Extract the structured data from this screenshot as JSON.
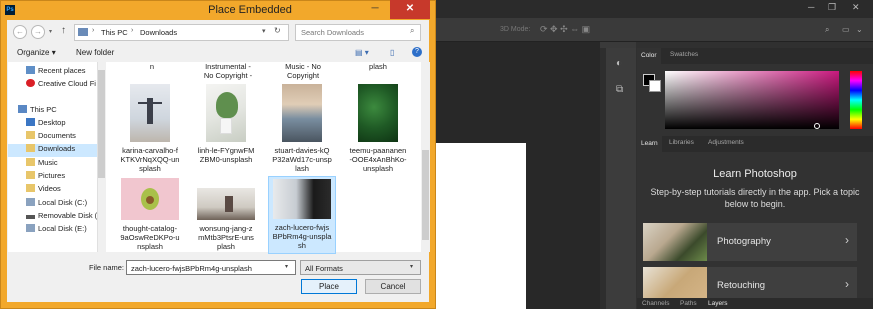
{
  "dialog": {
    "title": "Place Embedded",
    "app_icon": "Ps",
    "breadcrumb": [
      "This PC",
      "Downloads"
    ],
    "search_placeholder": "Search Downloads",
    "organize_label": "Organize",
    "new_folder_label": "New folder",
    "nav_items": [
      {
        "label": "Recent places",
        "icon": "recent-places-icon",
        "selected": false
      },
      {
        "label": "Creative Cloud Fi",
        "icon": "creative-cloud-icon",
        "selected": false
      },
      {
        "label": "This PC",
        "icon": "computer-icon",
        "selected": false
      },
      {
        "label": "Desktop",
        "icon": "folder-icon",
        "selected": false
      },
      {
        "label": "Documents",
        "icon": "folder-icon",
        "selected": false
      },
      {
        "label": "Downloads",
        "icon": "folder-icon",
        "selected": true
      },
      {
        "label": "Music",
        "icon": "music-icon",
        "selected": false
      },
      {
        "label": "Pictures",
        "icon": "folder-icon",
        "selected": false
      },
      {
        "label": "Videos",
        "icon": "folder-icon",
        "selected": false
      },
      {
        "label": "Local Disk (C:)",
        "icon": "disk-icon",
        "selected": false
      },
      {
        "label": "Removable Disk (",
        "icon": "removable-disk-icon",
        "selected": false
      },
      {
        "label": "Local Disk (E:)",
        "icon": "disk-icon",
        "selected": false
      }
    ],
    "truncated_top_items": [
      "n",
      "Instrumental -\nNo Copyright -",
      "Music - No\nCopyright",
      "plash"
    ],
    "files": [
      {
        "name": "karina-carvalho-fKTKVrNqXQQ-unsplash",
        "lines": [
          "karina-carvalho-f",
          "KTKVrNqXQQ-un",
          "splash"
        ],
        "selected": false
      },
      {
        "name": "linh-le-FYgnwFMZBM0-unsplash",
        "lines": [
          "linh-le-FYgnwFM",
          "ZBM0-unsplash"
        ],
        "selected": false
      },
      {
        "name": "stuart-davies-kQP32aWd17c-unsplash",
        "lines": [
          "stuart-davies-kQ",
          "P32aWd17c-unsp",
          "lash"
        ],
        "selected": false
      },
      {
        "name": "teemu-paananen-OOE4xAnBhKo-unsplash",
        "lines": [
          "teemu-paananen",
          "-OOE4xAnBhKo-",
          "unsplash"
        ],
        "selected": false
      },
      {
        "name": "thought-catalog-9aOswReDKPo-unsplash",
        "lines": [
          "thought-catalog-",
          "9aOswReDKPo-u",
          "nsplash"
        ],
        "selected": false
      },
      {
        "name": "wonsung-jang-zmMtb3PtsrE-unsplash",
        "lines": [
          "wonsung-jang-z",
          "mMtb3PtsrE-uns",
          "plash"
        ],
        "selected": false
      },
      {
        "name": "zach-lucero-fwjsBPbRm4g-unsplash",
        "lines": [
          "zach-lucero-fwjs",
          "BPbRm4g-unspla",
          "sh"
        ],
        "selected": true
      }
    ],
    "file_name_label": "File name:",
    "file_name_value": "zach-lucero-fwjsBPbRm4g-unsplash",
    "format_value": "All Formats",
    "place_label": "Place",
    "cancel_label": "Cancel"
  },
  "photoshop": {
    "mode_label": "3D Mode:",
    "panel_tabs_top": [
      "Color",
      "Swatches"
    ],
    "panel_tabs_mid": [
      "Learn",
      "Libraries",
      "Adjustments"
    ],
    "panel_tabs_bottom": [
      "Channels",
      "Paths",
      "Layers"
    ],
    "learn_title": "Learn Photoshop",
    "learn_subtitle": "Step-by-step tutorials directly in the app. Pick a topic below to begin.",
    "cards": [
      {
        "label": "Photography"
      },
      {
        "label": "Retouching"
      }
    ]
  }
}
